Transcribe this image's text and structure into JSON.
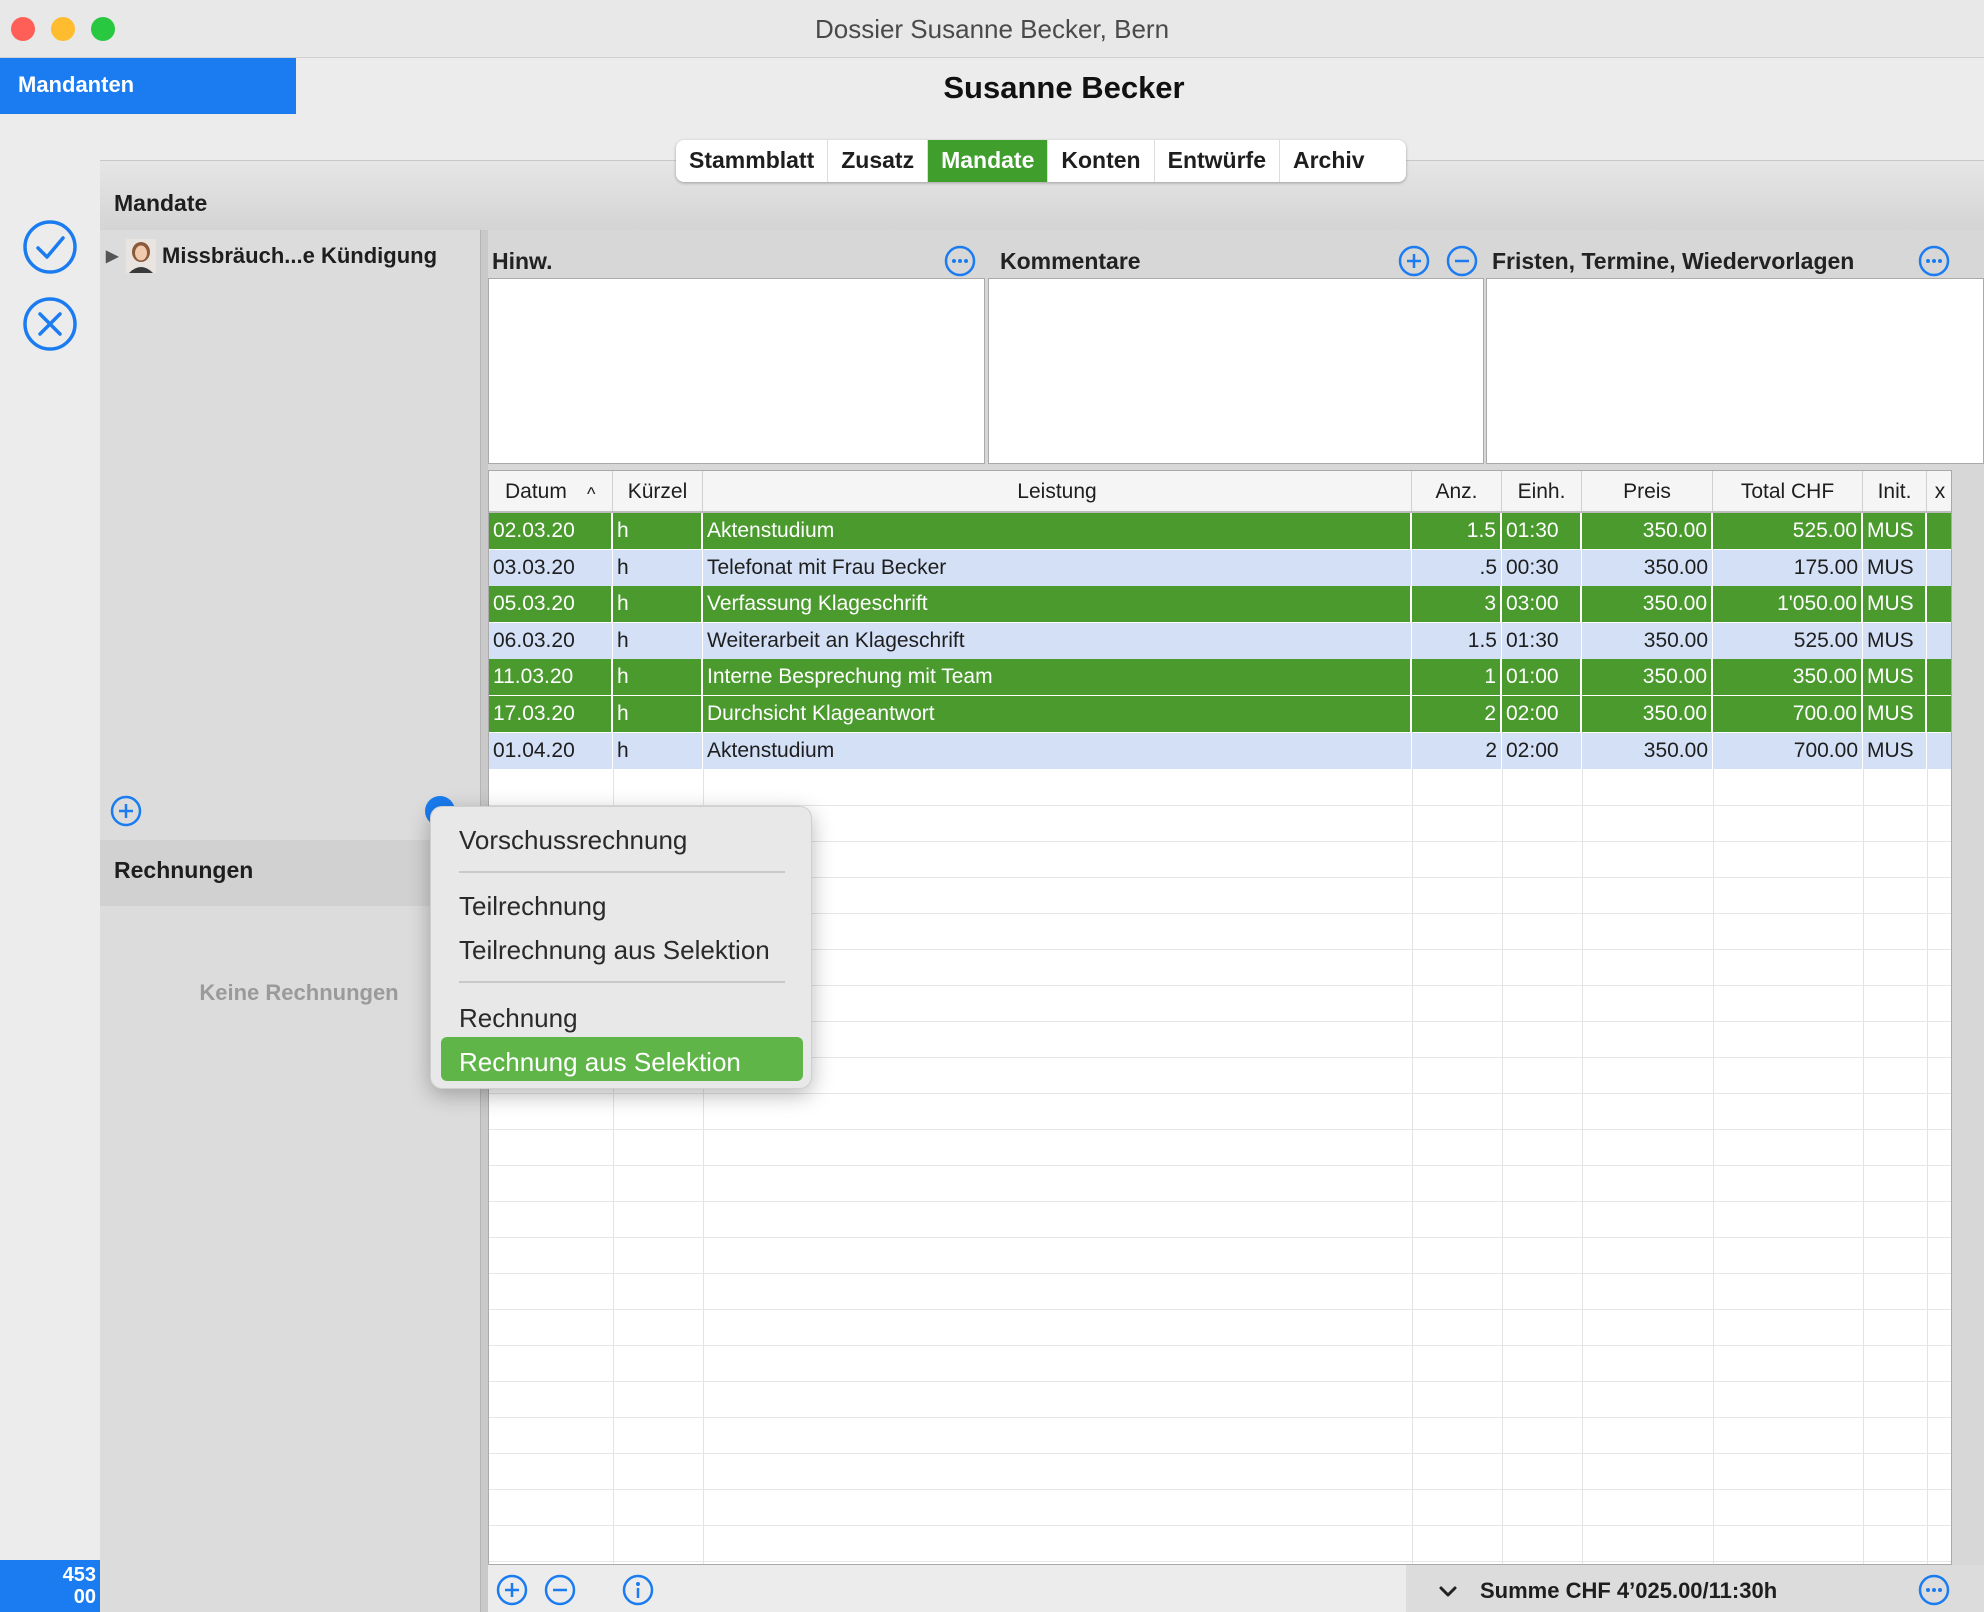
{
  "window": {
    "title": "Dossier Susanne Becker, Bern",
    "traffic_lights": {
      "close": "#ff5f57",
      "minimize": "#febc2e",
      "zoom": "#28c840"
    }
  },
  "sidebar": {
    "mandanten_label": "Mandanten",
    "counter_line1": "453",
    "counter_line2": "00"
  },
  "header": {
    "client_name": "Susanne Becker"
  },
  "tabs": [
    {
      "label": "Stammblatt",
      "active": false
    },
    {
      "label": "Zusatz",
      "active": false
    },
    {
      "label": "Mandate",
      "active": true
    },
    {
      "label": "Konten",
      "active": false
    },
    {
      "label": "Entwürfe",
      "active": false
    },
    {
      "label": "Archiv",
      "active": false
    }
  ],
  "mandate": {
    "title": "Mandate",
    "items": [
      {
        "label": "Missbräuch...e Kündigung"
      }
    ]
  },
  "rechnungen": {
    "title": "Rechnungen",
    "empty_text": "Keine Rechnungen"
  },
  "notes": {
    "hinweis_label": "Hinw.",
    "kommentare_label": "Kommentare",
    "fristen_label": "Fristen, Termine, Wiedervorlagen"
  },
  "table": {
    "columns": [
      "Datum",
      "Kürzel",
      "Leistung",
      "Anz.",
      "Einh.",
      "Preis",
      "Total CHF",
      "Init.",
      "x"
    ],
    "sort_indicator": "^",
    "rows": [
      {
        "datum": "02.03.20",
        "kuerzel": "h",
        "leistung": "Aktenstudium",
        "anz": "1.5",
        "einh": "01:30",
        "preis": "350.00",
        "total": "525.00",
        "init": "MUS",
        "selected": true
      },
      {
        "datum": "03.03.20",
        "kuerzel": "h",
        "leistung": "Telefonat mit Frau Becker",
        "anz": ".5",
        "einh": "00:30",
        "preis": "350.00",
        "total": "175.00",
        "init": "MUS",
        "selected": false
      },
      {
        "datum": "05.03.20",
        "kuerzel": "h",
        "leistung": "Verfassung Klageschrift",
        "anz": "3",
        "einh": "03:00",
        "preis": "350.00",
        "total": "1'050.00",
        "init": "MUS",
        "selected": true
      },
      {
        "datum": "06.03.20",
        "kuerzel": "h",
        "leistung": "Weiterarbeit an Klageschrift",
        "anz": "1.5",
        "einh": "01:30",
        "preis": "350.00",
        "total": "525.00",
        "init": "MUS",
        "selected": false
      },
      {
        "datum": "11.03.20",
        "kuerzel": "h",
        "leistung": "Interne Besprechung mit Team",
        "anz": "1",
        "einh": "01:00",
        "preis": "350.00",
        "total": "350.00",
        "init": "MUS",
        "selected": true
      },
      {
        "datum": "17.03.20",
        "kuerzel": "h",
        "leistung": "Durchsicht Klageantwort",
        "anz": "2",
        "einh": "02:00",
        "preis": "350.00",
        "total": "700.00",
        "init": "MUS",
        "selected": true
      },
      {
        "datum": "01.04.20",
        "kuerzel": "h",
        "leistung": "Aktenstudium",
        "anz": "2",
        "einh": "02:00",
        "preis": "350.00",
        "total": "700.00",
        "init": "MUS",
        "selected": false
      }
    ],
    "selected_color": "#4a9a2e",
    "normal_color": "#d3e0f6"
  },
  "footer": {
    "summe": "Summe CHF 4’025.00/11:30h"
  },
  "context_menu": {
    "items": [
      {
        "label": "Vorschussrechnung"
      },
      {
        "label": "Teilrechnung"
      },
      {
        "label": "Teilrechnung aus Selektion"
      },
      {
        "label": "Rechnung"
      },
      {
        "label": "Rechnung aus Selektion",
        "highlighted": true
      }
    ]
  },
  "accent_color": "#1a7cf0"
}
